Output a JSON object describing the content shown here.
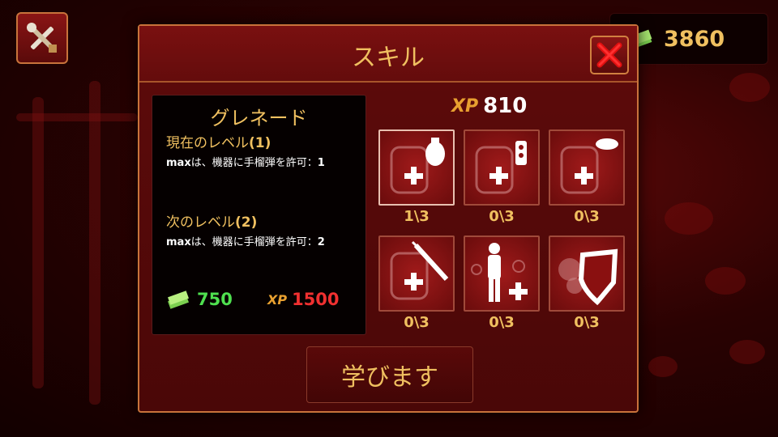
{
  "currency": {
    "value": "3860",
    "icon": "cash-stack-icon"
  },
  "dialog": {
    "title": "スキル",
    "close_icon": "close-x-icon"
  },
  "info": {
    "skill_name": "グレネード",
    "current_label": "現在のレベル",
    "current_value": "(1)",
    "current_desc_prefix": "max",
    "current_desc": "は、機器に手榴弾を許可：",
    "current_desc_value": "1",
    "next_label": "次のレベル",
    "next_value": "(2)",
    "next_desc_prefix": "max",
    "next_desc": "は、機器に手榴弾を許可：",
    "next_desc_value": "2",
    "cost_money": "750",
    "cost_xp_label": "XP",
    "cost_xp": "1500"
  },
  "xp": {
    "label": "XP",
    "value": "810"
  },
  "skills": [
    {
      "name": "grenade-skill",
      "icon": "grenade-icon",
      "level": "1\\3",
      "selected": true
    },
    {
      "name": "flashbang-skill",
      "icon": "flashbang-icon",
      "level": "0\\3",
      "selected": false
    },
    {
      "name": "mine-skill",
      "icon": "mine-icon",
      "level": "0\\3",
      "selected": false
    },
    {
      "name": "syringe-skill",
      "icon": "syringe-icon",
      "level": "0\\3",
      "selected": false
    },
    {
      "name": "soldier-skill",
      "icon": "soldier-icon",
      "level": "0\\3",
      "selected": false
    },
    {
      "name": "armor-skill",
      "icon": "shield-icon",
      "level": "0\\3",
      "selected": false
    }
  ],
  "learn_button": "学びます",
  "colors": {
    "gold": "#f0c060",
    "money": "#4fe04f",
    "xp_cost": "#f03030",
    "border": "#c8733b"
  }
}
